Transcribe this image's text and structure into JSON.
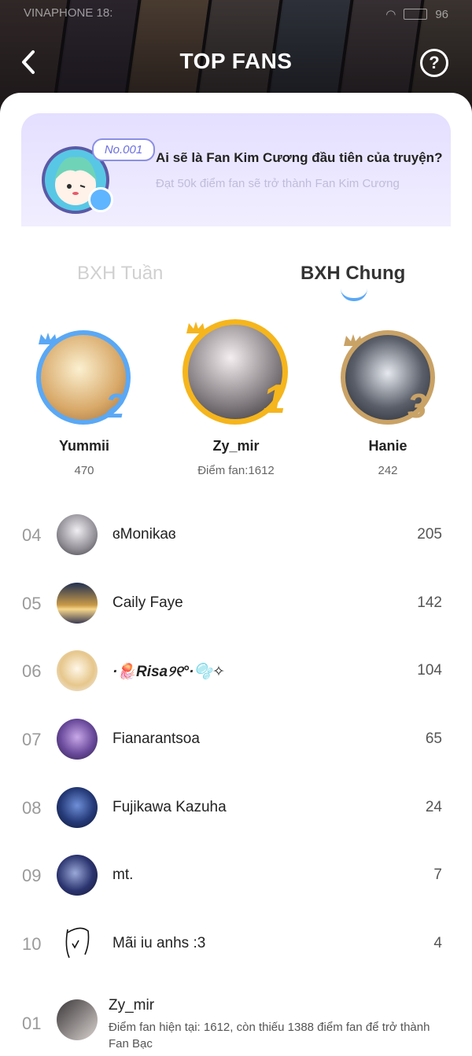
{
  "status_bar": {
    "carrier": "VINAPHONE",
    "time": "18:",
    "battery": "96"
  },
  "header": {
    "title": "TOP FANS",
    "help_glyph": "?"
  },
  "banner": {
    "badge": "No.001",
    "title": "Ai sẽ là Fan Kim Cương đầu tiên của truyện?",
    "subtitle": "Đạt 50k điểm fan sẽ trở thành Fan Kim Cương"
  },
  "tabs": [
    {
      "label": "BXH Tuần",
      "active": false
    },
    {
      "label": "BXH Chung",
      "active": true
    }
  ],
  "podium": {
    "first": {
      "rank": "1",
      "name": "Zy_mir",
      "points": "Điểm fan:1612"
    },
    "second": {
      "rank": "2",
      "name": "Yummii",
      "points": "470"
    },
    "third": {
      "rank": "3",
      "name": "Hanie",
      "points": "242"
    }
  },
  "list": [
    {
      "rank": "04",
      "name": "ɞMonikaɞ",
      "score": "205"
    },
    {
      "rank": "05",
      "name": "Caily Faye",
      "score": "142"
    },
    {
      "rank": "06",
      "name": "·🪼Risa୨୧°·🫧✧",
      "score": "104"
    },
    {
      "rank": "07",
      "name": "Fianarantsoa",
      "score": "65"
    },
    {
      "rank": "08",
      "name": "Fujikawa Kazuha",
      "score": "24"
    },
    {
      "rank": "09",
      "name": "mt.",
      "score": "7"
    },
    {
      "rank": "10",
      "name": "Mãi iu anhs :3",
      "score": "4"
    }
  ],
  "me": {
    "rank": "01",
    "name": "Zy_mir",
    "description": "Điểm fan hiện tại: 1612, còn thiếu 1388 điểm fan để trở thành Fan Bạc"
  },
  "colors": {
    "accent": "#5aa8f5",
    "gold": "#f5b51c",
    "silver": "#5aa8f5",
    "bronze": "#c9a266"
  }
}
